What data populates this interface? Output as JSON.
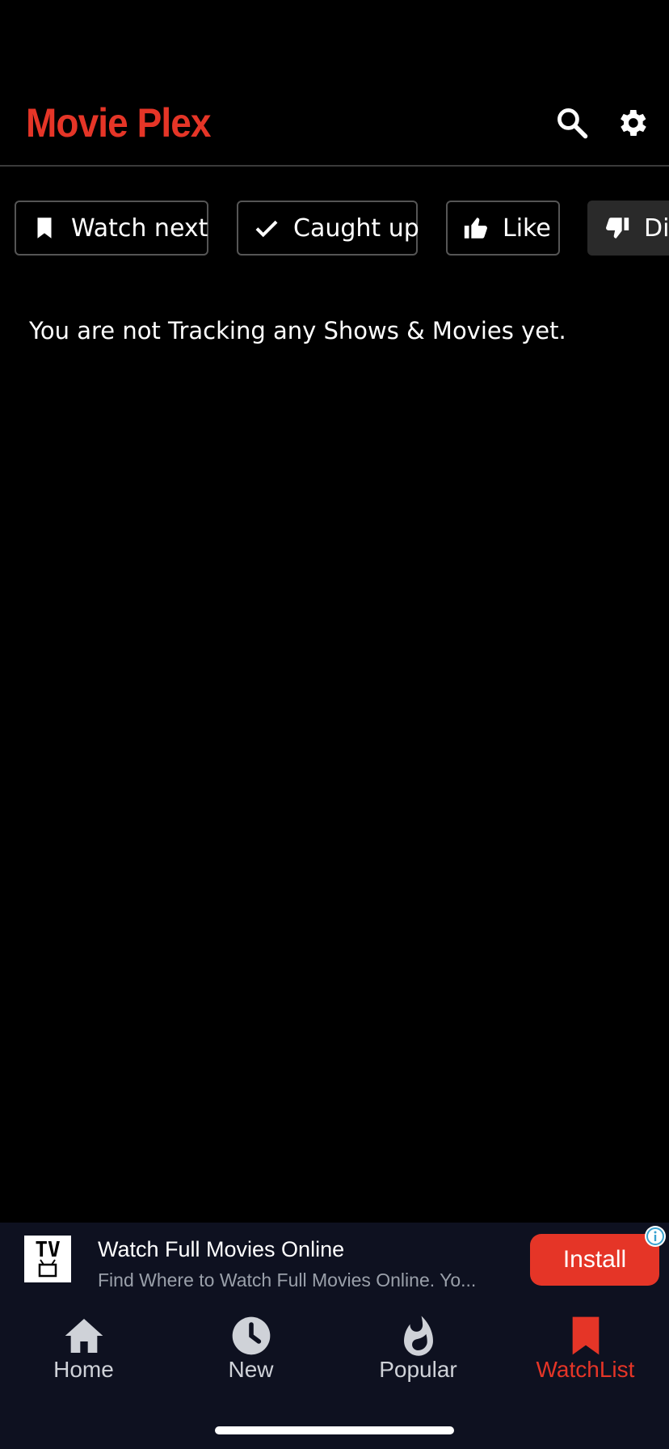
{
  "header": {
    "title": "Movie Plex"
  },
  "filters": [
    {
      "label": "Watch next",
      "icon": "bookmark-icon"
    },
    {
      "label": "Caught up",
      "icon": "check-icon"
    },
    {
      "label": "Like",
      "icon": "thumbs-up-icon"
    },
    {
      "label": "Di",
      "icon": "thumbs-down-icon"
    }
  ],
  "main": {
    "empty_message": "You are not Tracking any Shows & Movies yet."
  },
  "ad": {
    "logo_text": "TV",
    "title": "Watch Full Movies Online",
    "description": "Find Where to Watch Full Movies Online. Yo...",
    "install_label": "Install"
  },
  "nav": {
    "items": [
      {
        "label": "Home",
        "icon": "home-icon"
      },
      {
        "label": "New",
        "icon": "clock-icon"
      },
      {
        "label": "Popular",
        "icon": "flame-icon"
      },
      {
        "label": "WatchList",
        "icon": "bookmark-icon"
      }
    ],
    "active": "WatchList"
  },
  "colors": {
    "accent": "#e53527",
    "background": "#000000",
    "nav_background": "#0e1120",
    "chip_border": "#555555"
  }
}
